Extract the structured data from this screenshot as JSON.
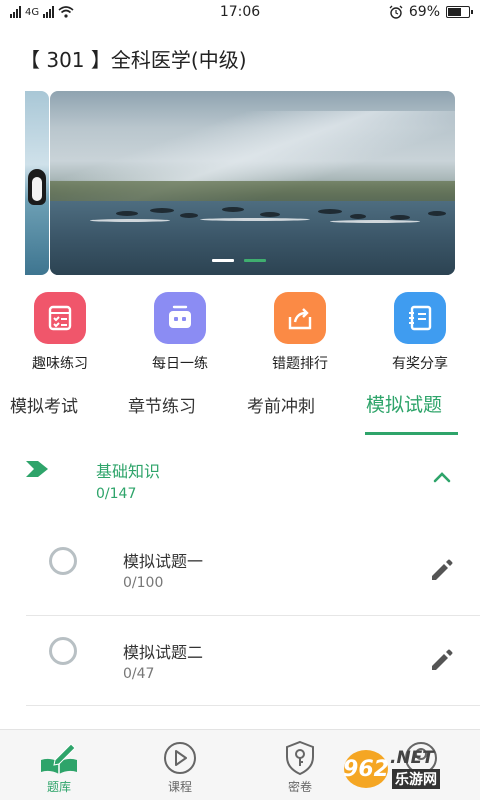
{
  "status_bar": {
    "network": "4G",
    "time": "17:06",
    "battery": "69%",
    "battery_level": 0.69
  },
  "page": {
    "title": "【 301 】全科医学(中级)"
  },
  "banner": {
    "slide_count": 2,
    "active_slide": 2
  },
  "quick_actions": [
    {
      "label": "趣味练习",
      "icon": "checklist-icon",
      "color": "#f0566b"
    },
    {
      "label": "每日一练",
      "icon": "robot-icon",
      "color": "#8b8cf3"
    },
    {
      "label": "错题排行",
      "icon": "share-box-icon",
      "color": "#fb8a45"
    },
    {
      "label": "有奖分享",
      "icon": "notebook-icon",
      "color": "#3f9cf0"
    }
  ],
  "tabs": [
    {
      "label": "模拟考试",
      "active": false
    },
    {
      "label": "章节练习",
      "active": false
    },
    {
      "label": "考前冲刺",
      "active": false
    },
    {
      "label": "模拟试题",
      "active": true
    }
  ],
  "chapter": {
    "title": "基础知识",
    "progress": "0/147",
    "expanded": true,
    "items": [
      {
        "title": "模拟试题一",
        "progress": "0/100"
      },
      {
        "title": "模拟试题二",
        "progress": "0/47"
      }
    ]
  },
  "bottom_nav": [
    {
      "label": "题库",
      "icon": "book-pen-icon",
      "active": true
    },
    {
      "label": "课程",
      "icon": "play-circle-icon",
      "active": false
    },
    {
      "label": "密卷",
      "icon": "shield-key-icon",
      "active": false
    },
    {
      "label": "",
      "icon": "profile-icon",
      "active": false
    }
  ],
  "watermark": {
    "number": "962",
    "suffix": ".NET",
    "site": "乐游网"
  },
  "colors": {
    "accent": "#2ea46a"
  }
}
